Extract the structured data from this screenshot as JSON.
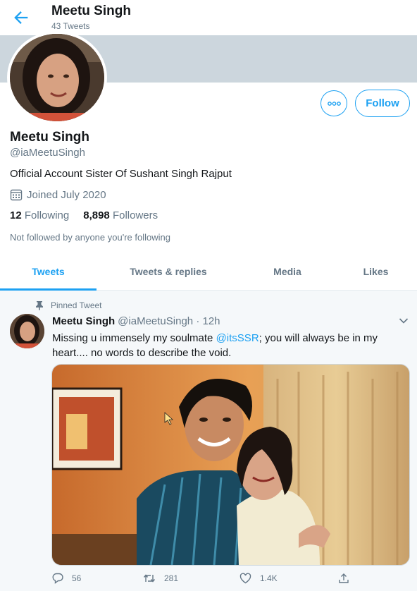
{
  "header": {
    "name": "Meetu Singh",
    "tweet_count": "43 Tweets"
  },
  "actions": {
    "follow_label": "Follow"
  },
  "profile": {
    "name": "Meetu Singh",
    "handle": "@iaMeetuSingh",
    "bio": "Official Account Sister Of Sushant Singh Rajput",
    "joined": "Joined July 2020",
    "following_count": "12",
    "following_label": "Following",
    "followers_count": "8,898",
    "followers_label": "Followers",
    "not_followed": "Not followed by anyone you're following"
  },
  "tabs": [
    {
      "label": "Tweets",
      "active": true
    },
    {
      "label": "Tweets & replies",
      "active": false
    },
    {
      "label": "Media",
      "active": false
    },
    {
      "label": "Likes",
      "active": false
    }
  ],
  "tweet": {
    "pinned_label": "Pinned Tweet",
    "author_name": "Meetu Singh",
    "author_handle": "@iaMeetuSingh",
    "time": "· 12h",
    "text_part1": "Missing u immensely  my soulmate ",
    "mention": "@itsSSR",
    "text_part2": "; you will always be in my heart.... no words to describe the void.",
    "replies": "56",
    "retweets": "281",
    "likes": "1.4K"
  },
  "colors": {
    "accent": "#1da1f2",
    "secondary_text": "#657786",
    "banner": "#ccd6dd"
  },
  "icons": [
    "back-arrow-icon",
    "more-icon",
    "calendar-icon",
    "pin-icon",
    "chevron-down-icon",
    "reply-icon",
    "retweet-icon",
    "like-icon",
    "share-icon"
  ]
}
